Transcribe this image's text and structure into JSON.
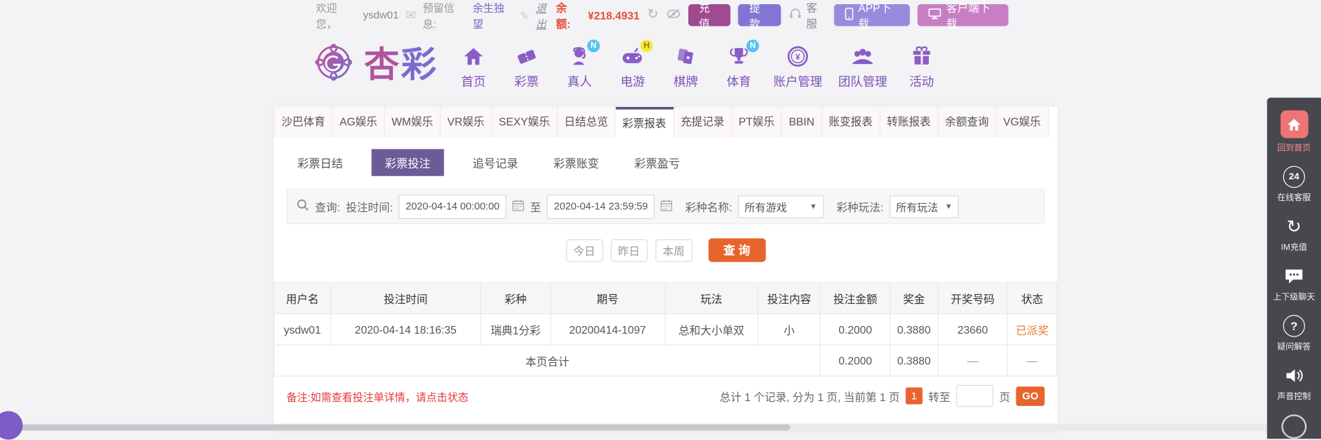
{
  "header": {
    "welcome_prefix": "欢迎您，",
    "username": "ysdw01",
    "reserved_label": "预留信息:",
    "reserved_value": "余生独望",
    "logout_label": "退出",
    "balance_label": "余额:",
    "balance_value": "¥218.4931",
    "recharge_label": "充值",
    "withdraw_label": "提款",
    "service_label": "客服",
    "app_download_label": "APP下载",
    "client_download_label": "客户端下载"
  },
  "logo": {
    "char1": "杏",
    "char2": "彩"
  },
  "nav": {
    "items": [
      {
        "label": "首页"
      },
      {
        "label": "彩票"
      },
      {
        "label": "真人",
        "badge": "N"
      },
      {
        "label": "电游",
        "badge": "H"
      },
      {
        "label": "棋牌"
      },
      {
        "label": "体育",
        "badge": "N"
      },
      {
        "label": "账户管理"
      },
      {
        "label": "团队管理"
      },
      {
        "label": "活动"
      }
    ]
  },
  "tabs": {
    "active": "彩票报表",
    "items": [
      "沙巴体育",
      "AG娱乐",
      "WM娱乐",
      "VR娱乐",
      "SEXY娱乐",
      "日结总览",
      "彩票报表",
      "充提记录",
      "PT娱乐",
      "BBIN",
      "账变报表",
      "转账报表",
      "余额查询",
      "VG娱乐"
    ]
  },
  "subtabs": {
    "active": "彩票投注",
    "items": [
      "彩票日结",
      "彩票投注",
      "追号记录",
      "彩票账变",
      "彩票盈亏"
    ]
  },
  "search": {
    "query_label": "查询:",
    "time_label": "投注时间:",
    "start_value": "2020-04-14 00:00:00",
    "to_label": "至",
    "end_value": "2020-04-14 23:59:59",
    "game_label": "彩种名称:",
    "game_value": "所有游戏",
    "play_label": "彩种玩法:",
    "play_value": "所有玩法"
  },
  "actions": {
    "today": "今日",
    "yesterday": "昨日",
    "week": "本周",
    "query": "查 询"
  },
  "table": {
    "headers": [
      "用户名",
      "投注时间",
      "彩种",
      "期号",
      "玩法",
      "投注内容",
      "投注金额",
      "奖金",
      "开奖号码",
      "状态"
    ],
    "rows": [
      [
        "ysdw01",
        "2020-04-14 18:16:35",
        "瑞典1分彩",
        "20200414-1097",
        "总和大小单双",
        "小",
        "0.2000",
        "0.3880",
        "23660",
        "已派奖"
      ]
    ],
    "total": {
      "label": "本页合计",
      "amount": "0.2000",
      "prize": "0.3880",
      "dash1": "—",
      "dash2": "—"
    }
  },
  "footer": {
    "note": "备注:如需查看投注单详情，请点击状态",
    "summary": "总计 1 个记录, 分为 1 页, 当前第 1 页",
    "current_page": "1",
    "goto_label": "转至",
    "page_unit": "页",
    "go_label": "GO"
  },
  "sidebar": {
    "items": [
      "回到首页",
      "在线客服",
      "IM充值",
      "上下级聊天",
      "疑问解答",
      "声音控制"
    ]
  },
  "icons": {
    "caret": "▼",
    "envelope": "✉",
    "edit": "✎",
    "refresh": "↻",
    "im_recharge": "↻",
    "question": "?",
    "service_24": "24"
  },
  "colors": {
    "accent_purple": "#6b5b97",
    "tab_border_purple": "#5b4a84",
    "orange": "#e8642d",
    "note_red": "#e4393c",
    "balance_red": "#e5503e",
    "status_orange": "#e87a3b"
  }
}
